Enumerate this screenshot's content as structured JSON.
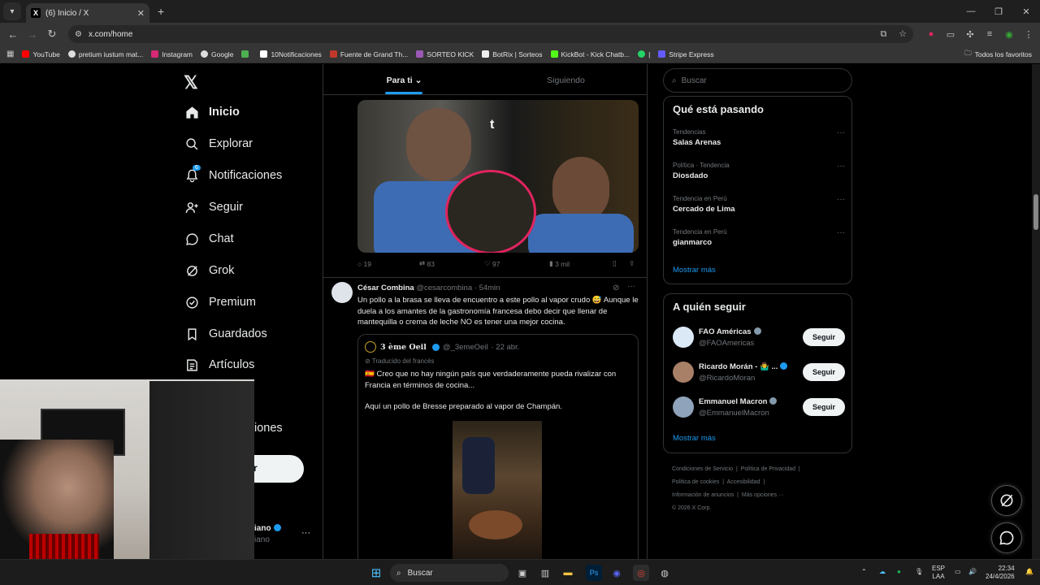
{
  "browser": {
    "tab_count_title": "(6) Inicio / X",
    "url": "x.com/home",
    "bookmarks": [
      "YouTube",
      "pretium iustum mat...",
      "Instagram",
      "Google",
      "10Notificaciones",
      "Fuente de Grand Th...",
      "SORTEO KICK",
      "BotRix | Sorteos",
      "KickBot - Kick Chatb...",
      "|",
      "Stripe Express"
    ],
    "all_bookmarks": "Todos los favoritos"
  },
  "nav": {
    "items": [
      {
        "label": "Inicio",
        "icon": "home-icon"
      },
      {
        "label": "Explorar",
        "icon": "search-icon"
      },
      {
        "label": "Notificaciones",
        "icon": "bell-icon",
        "badge": "6"
      },
      {
        "label": "Seguir",
        "icon": "person-add-icon"
      },
      {
        "label": "Chat",
        "icon": "chat-icon"
      },
      {
        "label": "Grok",
        "icon": "grok-icon"
      },
      {
        "label": "Premium",
        "icon": "premium-icon"
      },
      {
        "label": "Guardados",
        "icon": "bookmark-icon"
      },
      {
        "label": "Artículos",
        "icon": "articles-icon"
      }
    ],
    "peek_more": "iones",
    "peek_post": "r",
    "peek_account_name": "iano",
    "peek_account_handle": "iano"
  },
  "feed": {
    "tabs": [
      "Para ti",
      "Siguiendo"
    ],
    "post1_actions": {
      "replies": "19",
      "reposts": "83",
      "likes": "97",
      "views": "3 mil"
    },
    "post2": {
      "name": "César Combina",
      "handle": "@cesarcombina",
      "time": "· 54min",
      "text": "Un pollo a la brasa se lleva de encuentro a este pollo al vapor crudo 😅 Aunque le duela a los amantes de la gastronomía francesa debo decir que llenar de mantequilla o crema de leche NO es tener una mejor cocina.",
      "quote": {
        "name": "3 ème Oeil",
        "handle": "@_3emeOeil",
        "time": "· 22 abr.",
        "translated": "Traducido del francés",
        "text1": "🇪🇸 Creo que no hay ningún país que verdaderamente pueda rivalizar con Francia en términos de cocina...",
        "text2": "Aquí un pollo de Bresse preparado al vapor de Champán."
      }
    }
  },
  "sidebar": {
    "search_placeholder": "Buscar",
    "trending_title": "Qué está pasando",
    "trends": [
      {
        "context": "Tendencias",
        "topic": "Salas Arenas"
      },
      {
        "context": "Política · Tendencia",
        "topic": "Diosdado"
      },
      {
        "context": "Tendencia en Perú",
        "topic": "Cercado de Lima"
      },
      {
        "context": "Tendencia en Perú",
        "topic": "gianmarco"
      }
    ],
    "show_more": "Mostrar más",
    "follow_title": "A quién seguir",
    "follow": [
      {
        "name": "FAO Américas",
        "handle": "@FAOAmericas",
        "badge": "gray"
      },
      {
        "name": "Ricardo Morán - 🤷‍♂️ ...",
        "handle": "@RicardoMoran",
        "badge": "blue"
      },
      {
        "name": "Emmanuel Macron",
        "handle": "@EmmanuelMacron",
        "badge": "gray"
      }
    ],
    "follow_button": "Seguir",
    "footer": [
      "Condiciones de Servicio",
      "Política de Privacidad",
      "Política de cookies",
      "Accesibilidad",
      "Información de anuncios",
      "Más opciones ···",
      "© 2026 X Corp."
    ]
  },
  "taskbar": {
    "search": "Buscar",
    "lang1": "ESP",
    "lang2": "LAA",
    "time": "22:34",
    "date": "24/4/2026"
  },
  "colors": {
    "accent": "#1d9bf0",
    "background": "#000000",
    "border": "#2f3336",
    "muted": "#71767b"
  }
}
